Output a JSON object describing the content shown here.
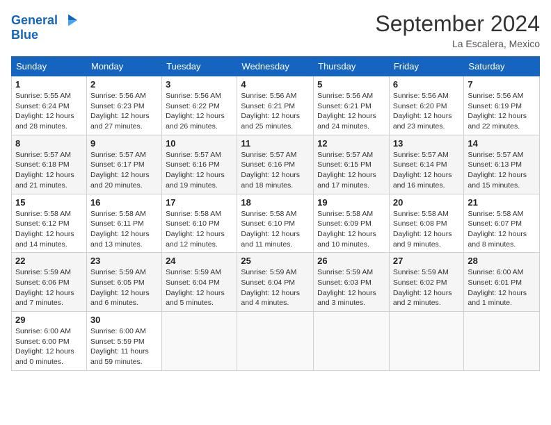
{
  "header": {
    "logo_line1": "General",
    "logo_line2": "Blue",
    "month": "September 2024",
    "location": "La Escalera, Mexico"
  },
  "weekdays": [
    "Sunday",
    "Monday",
    "Tuesday",
    "Wednesday",
    "Thursday",
    "Friday",
    "Saturday"
  ],
  "weeks": [
    [
      {
        "day": "1",
        "detail": "Sunrise: 5:55 AM\nSunset: 6:24 PM\nDaylight: 12 hours\nand 28 minutes."
      },
      {
        "day": "2",
        "detail": "Sunrise: 5:56 AM\nSunset: 6:23 PM\nDaylight: 12 hours\nand 27 minutes."
      },
      {
        "day": "3",
        "detail": "Sunrise: 5:56 AM\nSunset: 6:22 PM\nDaylight: 12 hours\nand 26 minutes."
      },
      {
        "day": "4",
        "detail": "Sunrise: 5:56 AM\nSunset: 6:21 PM\nDaylight: 12 hours\nand 25 minutes."
      },
      {
        "day": "5",
        "detail": "Sunrise: 5:56 AM\nSunset: 6:21 PM\nDaylight: 12 hours\nand 24 minutes."
      },
      {
        "day": "6",
        "detail": "Sunrise: 5:56 AM\nSunset: 6:20 PM\nDaylight: 12 hours\nand 23 minutes."
      },
      {
        "day": "7",
        "detail": "Sunrise: 5:56 AM\nSunset: 6:19 PM\nDaylight: 12 hours\nand 22 minutes."
      }
    ],
    [
      {
        "day": "8",
        "detail": "Sunrise: 5:57 AM\nSunset: 6:18 PM\nDaylight: 12 hours\nand 21 minutes."
      },
      {
        "day": "9",
        "detail": "Sunrise: 5:57 AM\nSunset: 6:17 PM\nDaylight: 12 hours\nand 20 minutes."
      },
      {
        "day": "10",
        "detail": "Sunrise: 5:57 AM\nSunset: 6:16 PM\nDaylight: 12 hours\nand 19 minutes."
      },
      {
        "day": "11",
        "detail": "Sunrise: 5:57 AM\nSunset: 6:16 PM\nDaylight: 12 hours\nand 18 minutes."
      },
      {
        "day": "12",
        "detail": "Sunrise: 5:57 AM\nSunset: 6:15 PM\nDaylight: 12 hours\nand 17 minutes."
      },
      {
        "day": "13",
        "detail": "Sunrise: 5:57 AM\nSunset: 6:14 PM\nDaylight: 12 hours\nand 16 minutes."
      },
      {
        "day": "14",
        "detail": "Sunrise: 5:57 AM\nSunset: 6:13 PM\nDaylight: 12 hours\nand 15 minutes."
      }
    ],
    [
      {
        "day": "15",
        "detail": "Sunrise: 5:58 AM\nSunset: 6:12 PM\nDaylight: 12 hours\nand 14 minutes."
      },
      {
        "day": "16",
        "detail": "Sunrise: 5:58 AM\nSunset: 6:11 PM\nDaylight: 12 hours\nand 13 minutes."
      },
      {
        "day": "17",
        "detail": "Sunrise: 5:58 AM\nSunset: 6:10 PM\nDaylight: 12 hours\nand 12 minutes."
      },
      {
        "day": "18",
        "detail": "Sunrise: 5:58 AM\nSunset: 6:10 PM\nDaylight: 12 hours\nand 11 minutes."
      },
      {
        "day": "19",
        "detail": "Sunrise: 5:58 AM\nSunset: 6:09 PM\nDaylight: 12 hours\nand 10 minutes."
      },
      {
        "day": "20",
        "detail": "Sunrise: 5:58 AM\nSunset: 6:08 PM\nDaylight: 12 hours\nand 9 minutes."
      },
      {
        "day": "21",
        "detail": "Sunrise: 5:58 AM\nSunset: 6:07 PM\nDaylight: 12 hours\nand 8 minutes."
      }
    ],
    [
      {
        "day": "22",
        "detail": "Sunrise: 5:59 AM\nSunset: 6:06 PM\nDaylight: 12 hours\nand 7 minutes."
      },
      {
        "day": "23",
        "detail": "Sunrise: 5:59 AM\nSunset: 6:05 PM\nDaylight: 12 hours\nand 6 minutes."
      },
      {
        "day": "24",
        "detail": "Sunrise: 5:59 AM\nSunset: 6:04 PM\nDaylight: 12 hours\nand 5 minutes."
      },
      {
        "day": "25",
        "detail": "Sunrise: 5:59 AM\nSunset: 6:04 PM\nDaylight: 12 hours\nand 4 minutes."
      },
      {
        "day": "26",
        "detail": "Sunrise: 5:59 AM\nSunset: 6:03 PM\nDaylight: 12 hours\nand 3 minutes."
      },
      {
        "day": "27",
        "detail": "Sunrise: 5:59 AM\nSunset: 6:02 PM\nDaylight: 12 hours\nand 2 minutes."
      },
      {
        "day": "28",
        "detail": "Sunrise: 6:00 AM\nSunset: 6:01 PM\nDaylight: 12 hours\nand 1 minute."
      }
    ],
    [
      {
        "day": "29",
        "detail": "Sunrise: 6:00 AM\nSunset: 6:00 PM\nDaylight: 12 hours\nand 0 minutes."
      },
      {
        "day": "30",
        "detail": "Sunrise: 6:00 AM\nSunset: 5:59 PM\nDaylight: 11 hours\nand 59 minutes."
      },
      {
        "day": "",
        "detail": ""
      },
      {
        "day": "",
        "detail": ""
      },
      {
        "day": "",
        "detail": ""
      },
      {
        "day": "",
        "detail": ""
      },
      {
        "day": "",
        "detail": ""
      }
    ]
  ]
}
